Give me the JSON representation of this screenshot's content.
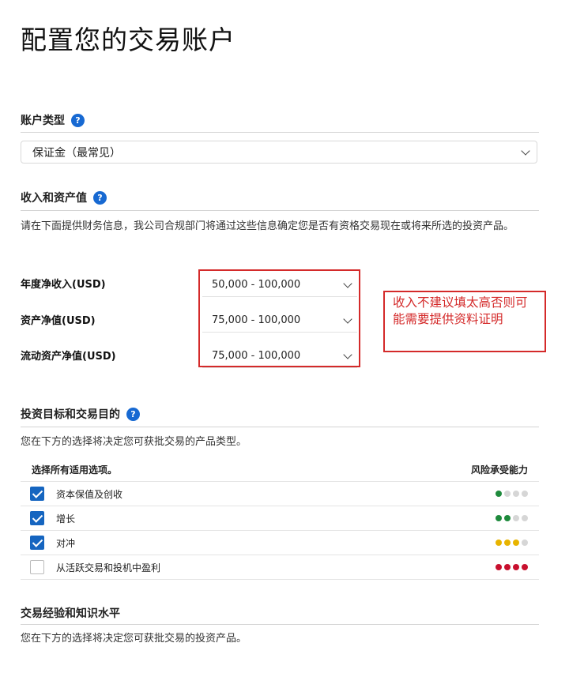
{
  "page": {
    "title": "配置您的交易账户"
  },
  "account_type": {
    "heading": "账户类型",
    "help": "?",
    "selected": "保证金（最常见）"
  },
  "income_assets": {
    "heading": "收入和资产值",
    "help": "?",
    "description": "请在下面提供财务信息，我公司合规部门将通过这些信息确定您是否有资格交易现在或将来所选的投资产品。",
    "fields": [
      {
        "label": "年度净收入(USD)",
        "value": "50,000 - 100,000"
      },
      {
        "label": "资产净值(USD)",
        "value": "75,000 - 100,000"
      },
      {
        "label": "流动资产净值(USD)",
        "value": "75,000 - 100,000"
      }
    ]
  },
  "annotation": {
    "text": "收入不建议填太高否则可能需要提供资料证明",
    "color": "#d42a2a"
  },
  "objectives": {
    "heading": "投资目标和交易目的",
    "help": "?",
    "description": "您在下方的选择将决定您可获批交易的产品类型。",
    "col_select": "选择所有适用选项。",
    "col_risk": "风险承受能力",
    "options": [
      {
        "label": "资本保值及创收",
        "checked": true,
        "risk": 1,
        "risk_color": "#1e8a3c"
      },
      {
        "label": "增长",
        "checked": true,
        "risk": 2,
        "risk_color": "#1e8a3c"
      },
      {
        "label": "对冲",
        "checked": true,
        "risk": 3,
        "risk_color": "#e8b400"
      },
      {
        "label": "从活跃交易和投机中盈利",
        "checked": false,
        "risk": 4,
        "risk_color": "#c8102e"
      }
    ]
  },
  "experience": {
    "heading": "交易经验和知识水平",
    "description": "您在下方的选择将决定您可获批交易的投资产品。"
  },
  "colors": {
    "accent": "#1565c0",
    "help_icon": "#1769d2",
    "annotation": "#d42a2a"
  }
}
